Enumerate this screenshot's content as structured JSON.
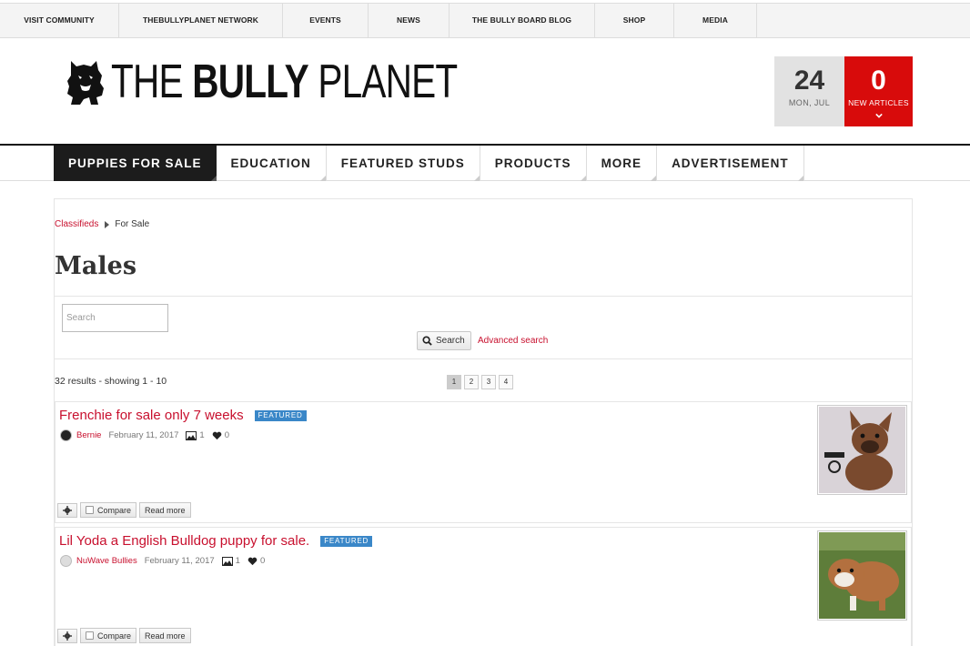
{
  "topnav": [
    {
      "label": "VISIT COMMUNITY"
    },
    {
      "label": "THEBULLYPLANET NETWORK"
    },
    {
      "label": "EVENTS"
    },
    {
      "label": "NEWS"
    },
    {
      "label": "THE BULLY BOARD BLOG"
    },
    {
      "label": "SHOP"
    },
    {
      "label": "MEDIA"
    }
  ],
  "logo": {
    "word1": "THE ",
    "word2": "BULLY",
    "word3": " PLANET"
  },
  "date_box": {
    "day": "24",
    "sub": "MON, JUL"
  },
  "new_articles": {
    "count": "0",
    "label": "NEW ARTICLES"
  },
  "mainnav": [
    {
      "label": "PUPPIES FOR SALE",
      "active": true
    },
    {
      "label": "EDUCATION"
    },
    {
      "label": "FEATURED STUDS"
    },
    {
      "label": "PRODUCTS"
    },
    {
      "label": "MORE"
    },
    {
      "label": "ADVERTISEMENT"
    }
  ],
  "breadcrumb": {
    "root": "Classifieds",
    "current": "For Sale"
  },
  "page_title": "Males",
  "search": {
    "placeholder": "Search",
    "button": "Search",
    "advanced": "Advanced search"
  },
  "results": {
    "text": "32 results - showing 1 - 10",
    "pages": [
      "1",
      "2",
      "3",
      "4"
    ],
    "current_page": "1"
  },
  "listings": [
    {
      "title": "Frenchie for sale only 7 weeks",
      "badge": "FEATURED",
      "author": "Bernie",
      "date": "February 11, 2017",
      "images": "1",
      "likes": "0",
      "compare": "Compare",
      "read_more": "Read more",
      "thumb_colors": {
        "bg": "#d9d3d8",
        "dog": "#7a4a2e",
        "dark": "#3b2418"
      }
    },
    {
      "title": "Lil Yoda a English Bulldog puppy for sale.",
      "badge": "FEATURED",
      "author": "NuWave Bullies",
      "date": "February 11, 2017",
      "images": "1",
      "likes": "0",
      "compare": "Compare",
      "read_more": "Read more",
      "thumb_colors": {
        "bg": "#5e7d3a",
        "dog": "#b3703f",
        "dark": "#f1ece4"
      }
    }
  ],
  "colors": {
    "brand_red": "#d80b0b",
    "link_red": "#c8102e",
    "badge_blue": "#3a87c8"
  }
}
